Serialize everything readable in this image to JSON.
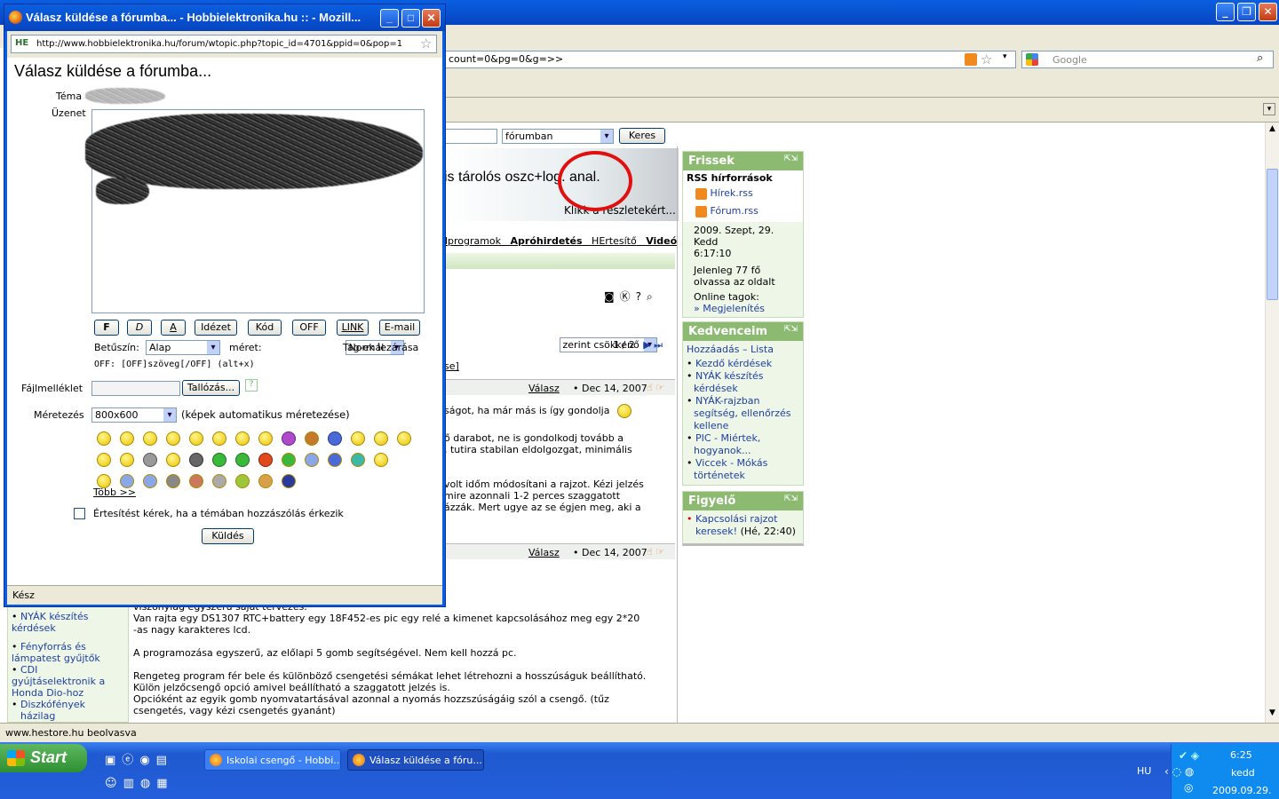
{
  "main_window": {
    "url_fragment": "count=0&pg=0&g=>>",
    "search_placeholder": "Google",
    "status": "www.hestore.hu beolvasva"
  },
  "page": {
    "search_scope": "fórumban",
    "search_button": "Keres",
    "banner_text": "is tárolós oszc+log. anal.",
    "banner_link": "Klikk a részletekért...",
    "nav_links": [
      "dprogramok",
      "Apróhirdetés",
      "HErtesítő",
      "Videó"
    ],
    "sort_select": "zerint csökkenő",
    "pagination": "1 / 2",
    "bracket_fragment": "se]",
    "post1": {
      "reply": "Válasz",
      "date": "• Dec 14, 2007",
      "line1": "ságot, ha már más is így gondolja",
      "line2": "ő darabot, ne is gondolkodj tovább a",
      "line3": ", tutira stabilan eldolgozgat, minimális",
      "line4": "volt időm módosítani a rajzot. Kézi jelzés",
      "line5": "mire azonnali 1-2 perces szaggatott",
      "line6": "ázzák. Mert ugye az se égjen meg, aki a"
    },
    "post2": {
      "reply": "Válasz",
      "date": "• Dec 14, 2007",
      "lines": [
        "viszonylag egyszerű saját tervezés.",
        "Van rajta egy DS1307 RTC+battery egy 18F452-es pic egy relé a kimenet kapcsolásához meg egy 2*20",
        "-as nagy karakteres lcd.",
        "",
        "A programozása egyszerű, az előlapi 5 gomb segítségével. Nem kell hozzá pc.",
        "",
        "Rengeteg program fér bele és különböző csengetési sémákat lehet létrehozni a hosszúságuk beállítható.",
        "Külön jelzőcsengő opció amivel beállítható a szaggatott jelzés is.",
        "Opcióként az egyik gomb nyomvatartásával azonnal a nyomás hozzszúságáig szól a csengő. (tűz",
        "csengetés, vagy kézi csengetés gyanánt)"
      ]
    },
    "left_list": [
      "NYÁK készítés kérdések",
      "Fényforrás és lámpatest gyűjtők",
      "CDI gyújtáselektronik a Honda Dio-hoz",
      "Diszkófények"
    ],
    "left_list_fragment": "házilag",
    "sidebar": {
      "frissek": {
        "title": "Frissek",
        "rss_title": "RSS hírforrások",
        "rss": [
          "Hírek.rss",
          "Fórum.rss"
        ],
        "date": "2009. Szept, 29.",
        "day": "Kedd",
        "time": "6:17:10",
        "readers": "Jelenleg 77 fő olvassa az oldalt",
        "online": "Online tagok:",
        "online_link": "» Megjelenítés"
      },
      "kedvenceim": {
        "title": "Kedvenceim",
        "add": "Hozzáadás",
        "sep": " – ",
        "list": "Lista",
        "items": [
          "Kezdő kérdések",
          "NYÁK készítés kérdések",
          "NYÁK-rajzban segítség, ellenőrzés kellene",
          "PIC - Miértek, hogyanok...",
          "Viccek - Mókás történetek"
        ]
      },
      "figyelo": {
        "title": "Figyelő",
        "item": "Kapcsolási rajzot keresek!",
        "meta": "(Hé, 22:40)"
      }
    }
  },
  "popup": {
    "title": "Válasz küldése a fórumba... - Hobbielektronika.hu :: - Mozill...",
    "url": "http://www.hobbielektronika.hu/forum/wtopic.php?topic_id=4701&ppid=0&pop=1",
    "url_badge": "HE",
    "heading": "Válasz küldése a fórumba...",
    "topic_label": "Téma",
    "message_label": "Üzenet",
    "format_buttons": [
      "F",
      "D",
      "A",
      "Idézet",
      "Kód",
      "OFF",
      "LINK",
      "E-mail"
    ],
    "color_label": "Betűszín:",
    "color_value": "Alap",
    "size_label": "méret:",
    "size_value": "Normál",
    "close_tags": "Tag-ek lezárása",
    "off_hint": "OFF: [OFF]szöveg[/OFF] (alt+x)",
    "attach_label": "Fájlmelléklet",
    "browse_button": "Tallózás...",
    "help_mark": "?",
    "resize_label": "Méretezés",
    "resize_value": "800x600",
    "resize_hint": "(képek automatikus méretezése)",
    "more_smileys": "Több >>",
    "notify_label": "Értesítést kérek, ha a témában hozzászólás érkezik",
    "send_button": "Küldés",
    "status": "Kész"
  },
  "taskbar": {
    "start": "Start",
    "tasks": [
      "Iskolai csengő - Hobbi...",
      "Válasz küldése a fóru..."
    ],
    "lang": "HU",
    "time": "6:25",
    "day": "kedd",
    "date": "2009.09.29."
  }
}
